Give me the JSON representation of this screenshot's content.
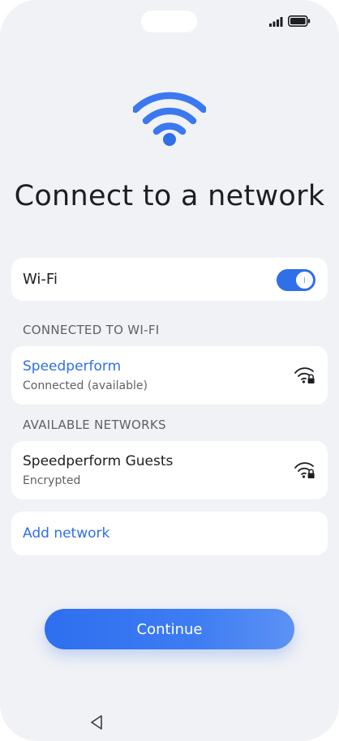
{
  "status_bar": {
    "icons": [
      "signal-icon",
      "battery-icon"
    ]
  },
  "hero": {
    "icon": "wifi-icon",
    "title": "Connect to a network"
  },
  "wifi_toggle": {
    "label": "Wi-Fi",
    "enabled": true
  },
  "connected_section": {
    "header": "CONNECTED TO WI-FI",
    "network": {
      "name": "Speedperform",
      "status": "Connected (available)",
      "icon": "wifi-lock-icon"
    }
  },
  "available_section": {
    "header": "AVAILABLE NETWORKS",
    "networks": [
      {
        "name": "Speedperform Guests",
        "status": "Encrypted",
        "icon": "wifi-lock-icon"
      }
    ]
  },
  "add_network": {
    "label": "Add network"
  },
  "continue_button": {
    "label": "Continue"
  },
  "nav_bar": {
    "icons": [
      "back-icon"
    ]
  },
  "colors": {
    "accent": "#2f6fe8",
    "background": "#f1f2f6",
    "card": "#ffffff",
    "text_primary": "#1d1e22",
    "text_secondary": "#5f6168"
  }
}
